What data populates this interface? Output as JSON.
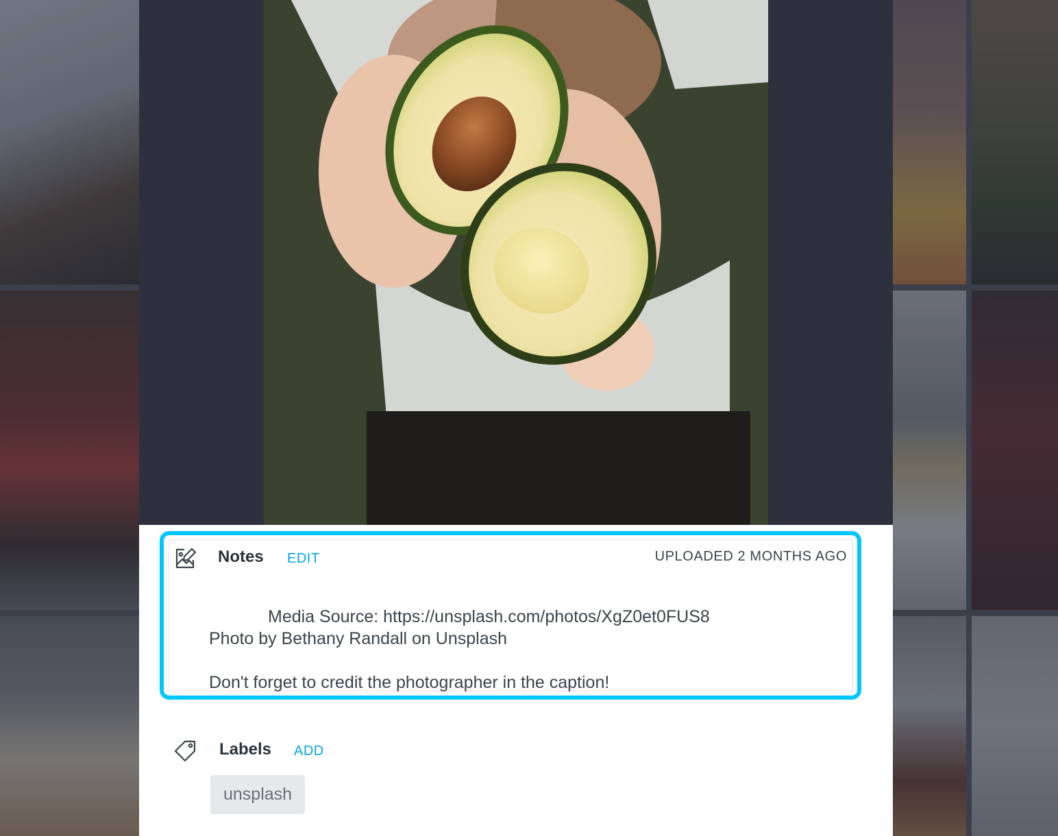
{
  "notes": {
    "title": "Notes",
    "edit_label": "EDIT",
    "uploaded": "UPLOADED 2 MONTHS AGO",
    "lines": [
      "Media Source: https://unsplash.com/photos/XgZ0et0FUS8",
      "Photo by Bethany Randall on Unsplash",
      "Don't forget to credit the photographer in the caption!"
    ],
    "icon": "edit-image-icon",
    "highlight_color": "#00c6ff"
  },
  "labels": {
    "title": "Labels",
    "add_label": "ADD",
    "icon": "tag-icon",
    "items": [
      "unsplash"
    ]
  },
  "colors": {
    "accent": "#00a6e3",
    "backdrop": "#2c313d"
  }
}
